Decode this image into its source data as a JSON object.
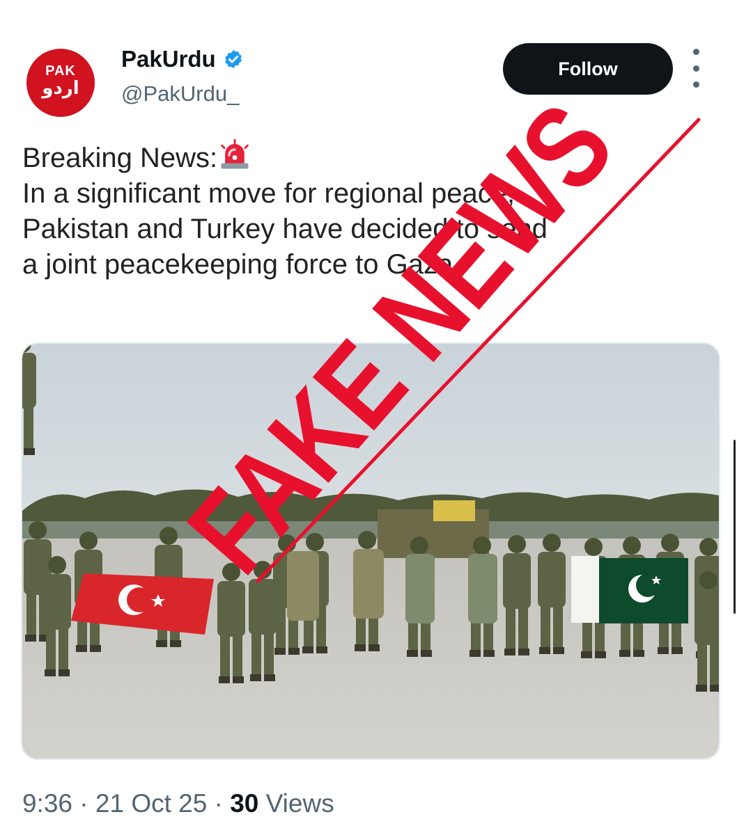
{
  "account": {
    "avatar_text_top": "PAK",
    "avatar_text_bottom": "اردو",
    "name": "PakUrdu",
    "handle": "@PakUrdu_",
    "follow_label": "Follow",
    "verified_icon": "verified-badge-icon",
    "more_icon": "more-vertical-icon"
  },
  "tweet": {
    "lines": [
      "Breaking News:",
      "In a significant move for regional peace,",
      "Pakistan and Turkey have decided to send",
      "a joint peacekeeping force to Gaza."
    ],
    "emoji": "rotating-light-icon"
  },
  "media": {
    "description_icon": "tweet-photo"
  },
  "footer": {
    "time": "9:36",
    "separator": "·",
    "date": "21 Oct 25",
    "views_count": "30",
    "views_label": "Views"
  },
  "overlay": {
    "stamp_text": "FAKE NEWS",
    "stamp_color": "#e8112d"
  },
  "colors": {
    "brand": "#d1121f",
    "verified": "#1d9bf0",
    "follow_bg": "#0f1419",
    "muted": "#536471"
  }
}
